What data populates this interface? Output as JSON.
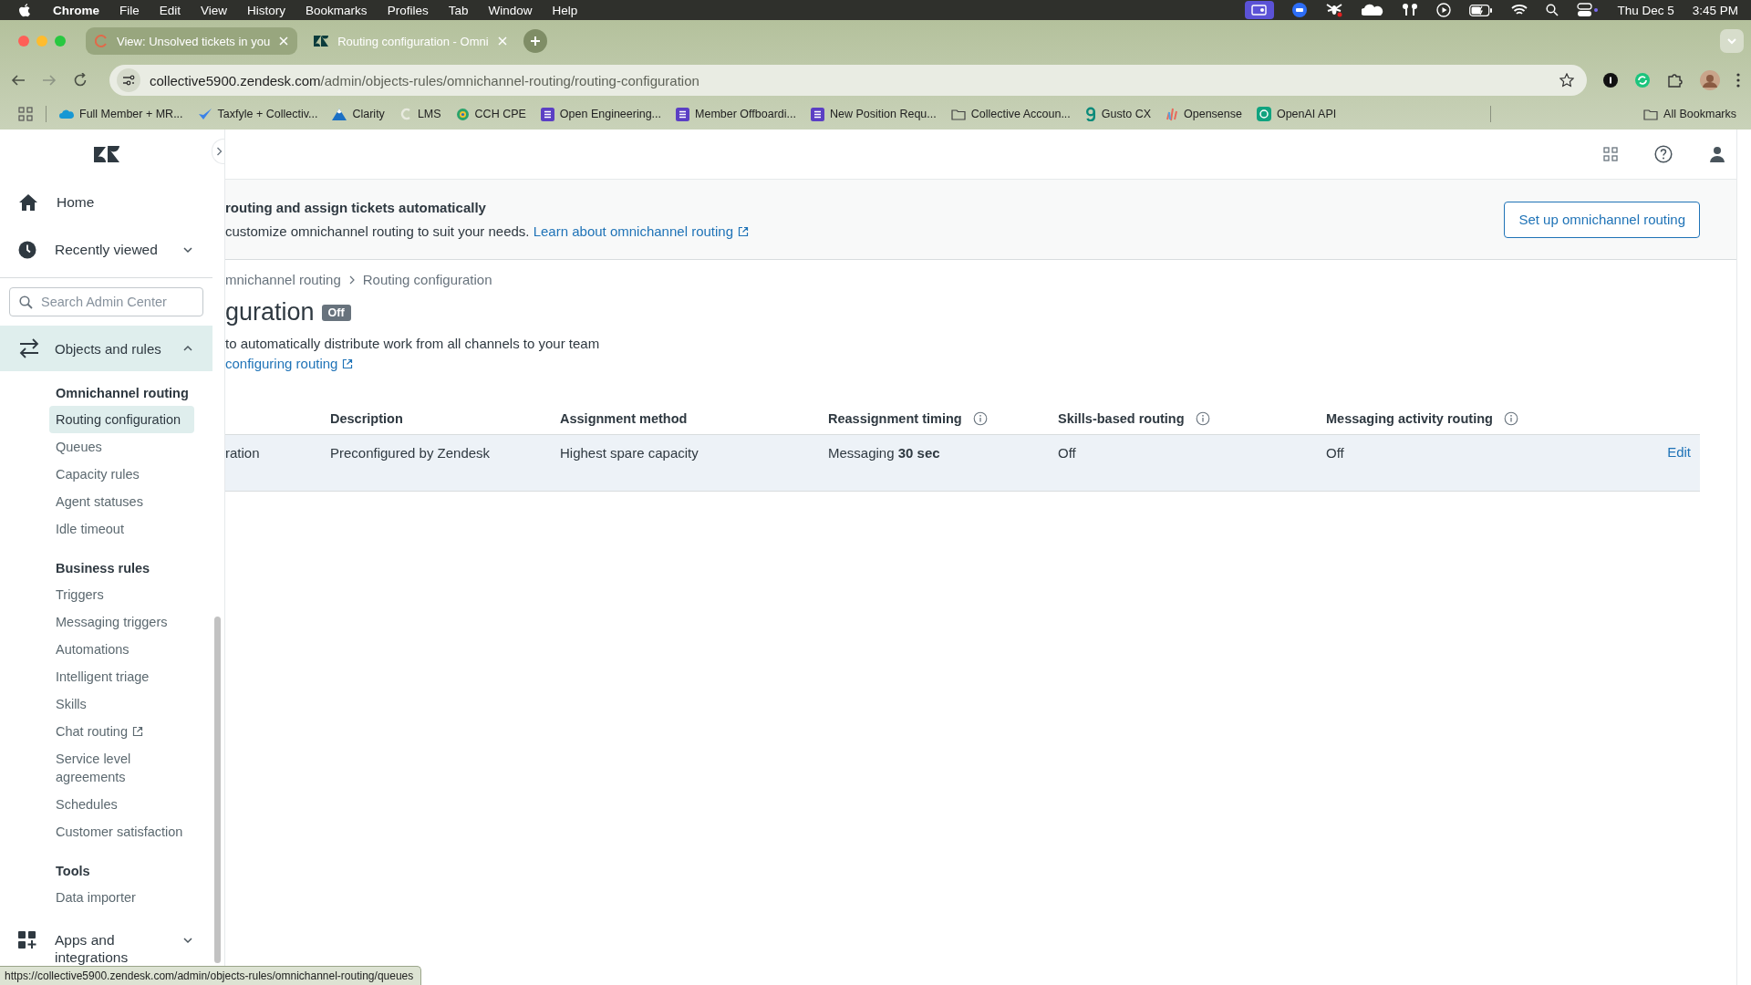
{
  "menubar": {
    "app": "Chrome",
    "menus": [
      "File",
      "Edit",
      "View",
      "History",
      "Bookmarks",
      "Profiles",
      "Tab",
      "Window",
      "Help"
    ],
    "date": "Thu Dec 5",
    "time": "3:45 PM"
  },
  "browser": {
    "tabs": [
      {
        "title": "View: Unsolved tickets in you",
        "selected": false
      },
      {
        "title": "Routing configuration - Omni",
        "selected": true
      }
    ],
    "address": {
      "host": "collective5900.zendesk.com",
      "path": "/admin/objects-rules/omnichannel-routing/routing-configuration"
    },
    "bookmarks": [
      {
        "label": "Full Member + MR...",
        "kind": "cloud"
      },
      {
        "label": "Taxfyle + Collectiv...",
        "kind": "check"
      },
      {
        "label": "Clarity",
        "kind": "mountain"
      },
      {
        "label": "LMS",
        "kind": "leaf"
      },
      {
        "label": "CCH CPE",
        "kind": "globe"
      },
      {
        "label": "Open Engineering...",
        "kind": "list"
      },
      {
        "label": "Member Offboardi...",
        "kind": "list"
      },
      {
        "label": "New Position Requ...",
        "kind": "list"
      },
      {
        "label": "Collective Accoun...",
        "kind": "folder"
      },
      {
        "label": "Gusto CX",
        "kind": "hook"
      },
      {
        "label": "Opensense",
        "kind": "bars"
      },
      {
        "label": "OpenAI API",
        "kind": "swirl"
      }
    ],
    "all_bookmarks": "All Bookmarks"
  },
  "sidebar": {
    "nav": [
      {
        "label": "Home",
        "kind": "home"
      },
      {
        "label": "Recently viewed",
        "kind": "recent",
        "expanded": false
      }
    ],
    "search": {
      "placeholder": "Search Admin Center"
    },
    "category": {
      "label": "Objects and rules",
      "expanded": true,
      "selected": true
    },
    "sections": [
      {
        "heading": "Omnichannel routing",
        "items": [
          {
            "label": "Routing configuration",
            "selected": true,
            "external": false
          },
          {
            "label": "Queues",
            "selected": false,
            "external": false
          },
          {
            "label": "Capacity rules",
            "selected": false,
            "external": false
          },
          {
            "label": "Agent statuses",
            "selected": false,
            "external": false
          },
          {
            "label": "Idle timeout",
            "selected": false,
            "external": false
          }
        ]
      },
      {
        "heading": "Business rules",
        "items": [
          {
            "label": "Triggers",
            "selected": false,
            "external": false
          },
          {
            "label": "Messaging triggers",
            "selected": false,
            "external": false
          },
          {
            "label": "Automations",
            "selected": false,
            "external": false
          },
          {
            "label": "Intelligent triage",
            "selected": false,
            "external": false
          },
          {
            "label": "Skills",
            "selected": false,
            "external": false
          },
          {
            "label": "Chat routing",
            "selected": false,
            "external": true
          },
          {
            "label": "Service level agreements",
            "selected": false,
            "external": false
          },
          {
            "label": "Schedules",
            "selected": false,
            "external": false
          },
          {
            "label": "Customer satisfaction",
            "selected": false,
            "external": false
          }
        ]
      },
      {
        "heading": "Tools",
        "items": [
          {
            "label": "Data importer",
            "selected": false,
            "external": false
          }
        ]
      }
    ],
    "footer": {
      "label": "Apps and integrations",
      "expanded": false
    }
  },
  "main": {
    "banner": {
      "title": "routing and assign tickets automatically",
      "text": "customize omnichannel routing to suit your needs.",
      "link": "Learn about omnichannel routing",
      "button": "Set up omnichannel routing"
    },
    "breadcrumb": [
      "mnichannel routing",
      "Routing configuration"
    ],
    "title": "guration",
    "status": "Off",
    "description": "to automatically distribute work from all channels to your team",
    "doc_link": "configuring routing",
    "table": {
      "columns": [
        {},
        {
          "label": "Description",
          "info": false
        },
        {
          "label": "Assignment method",
          "info": false
        },
        {
          "label": "Reassignment timing",
          "info": true
        },
        {
          "label": "Skills-based routing",
          "info": true
        },
        {
          "label": "Messaging activity routing",
          "info": true
        }
      ],
      "rows": [
        {
          "selected": true,
          "cells": [
            "ration",
            "Preconfigured by Zendesk",
            "Highest spare capacity",
            "Messaging **30 sec**",
            "Off",
            "Off"
          ],
          "action": "Edit"
        }
      ]
    }
  },
  "status_url": "https://collective5900.zendesk.com/admin/objects-rules/omnichannel-routing/queues"
}
